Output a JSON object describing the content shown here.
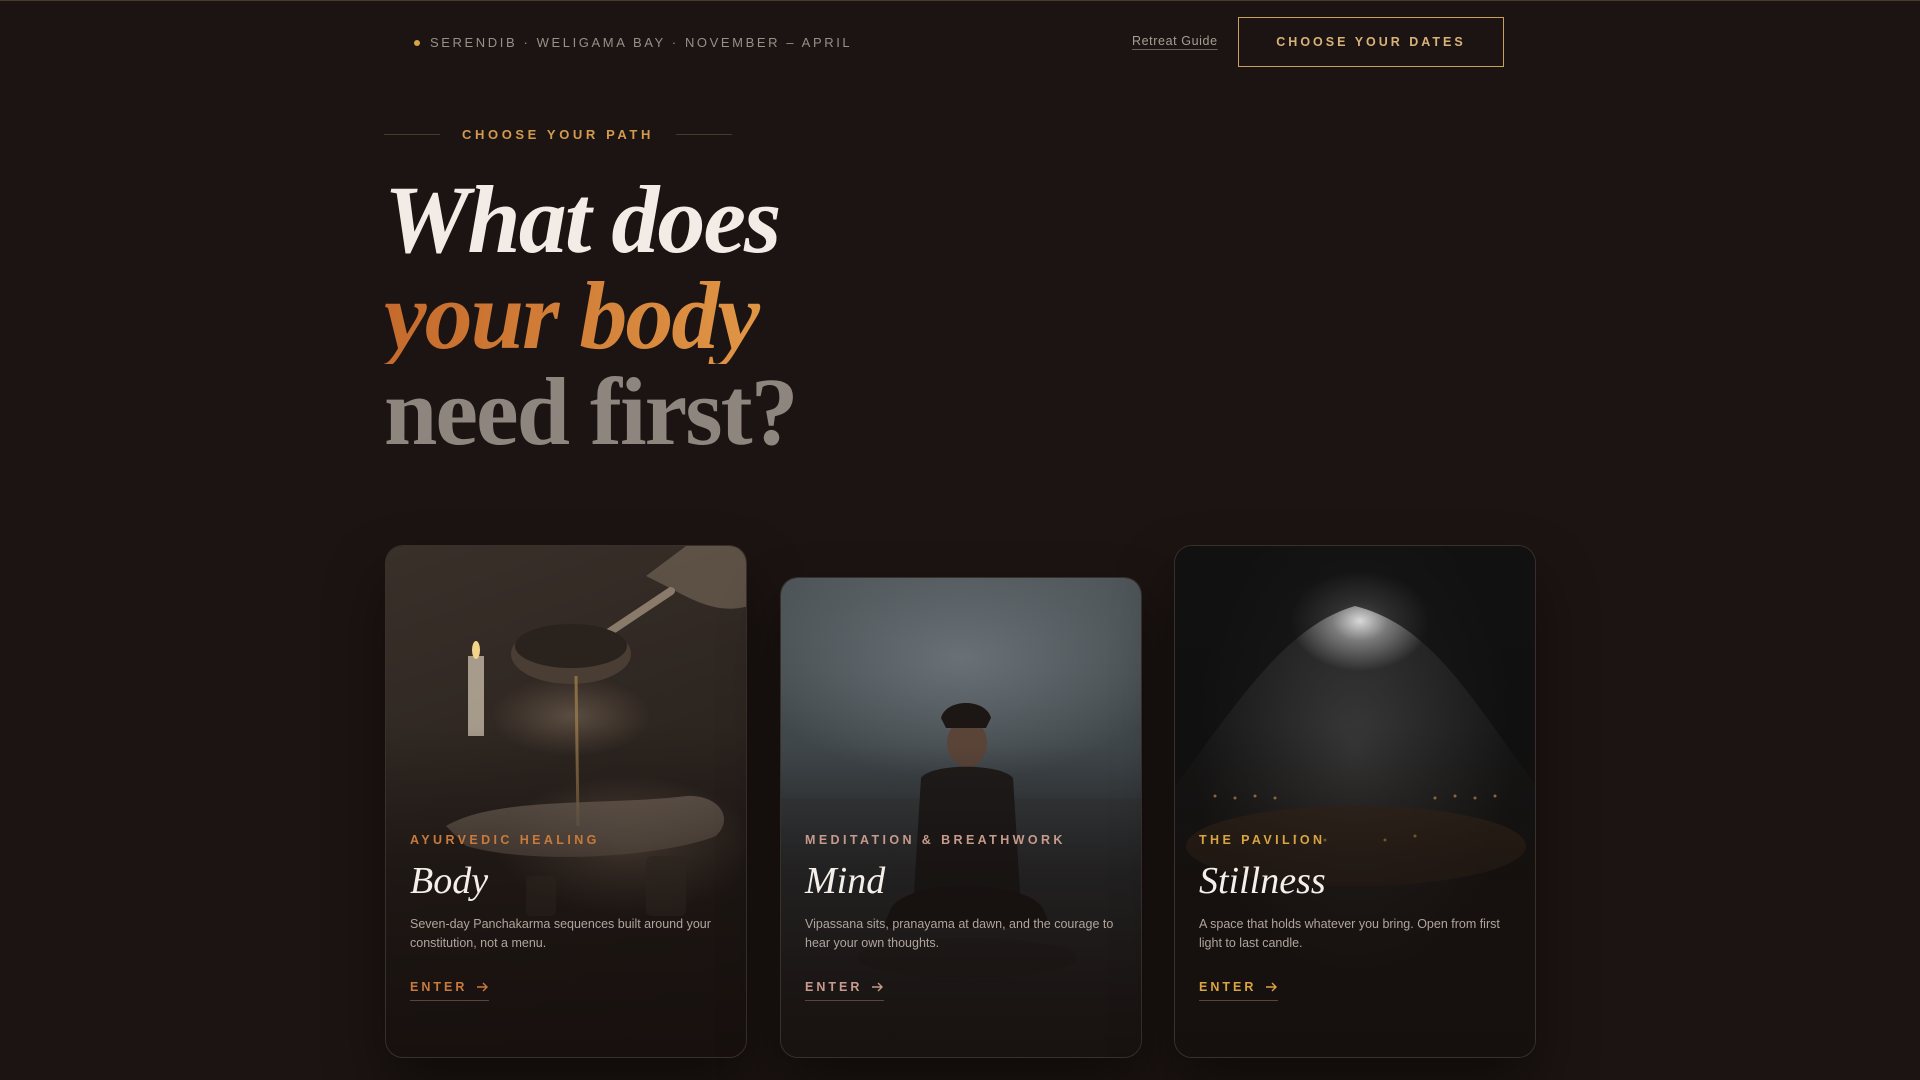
{
  "header": {
    "brand": "SERENDIB · WELIGAMA BAY · NOVEMBER – APRIL",
    "guide_link": "Retreat Guide",
    "cta": "CHOOSE YOUR DATES"
  },
  "hero": {
    "eyebrow": "CHOOSE YOUR PATH",
    "line1": "What does",
    "line2": "your body",
    "line3": "need first?"
  },
  "cards": [
    {
      "kicker": "AYURVEDIC HEALING",
      "title": "Body",
      "description": "Seven-day Panchakarma sequences built around your constitution, not a menu.",
      "action": "ENTER",
      "accent": "#c87a3c"
    },
    {
      "kicker": "MEDITATION & BREATHWORK",
      "title": "Mind",
      "description": "Vipassana sits, pranayama at dawn, and the courage to hear your own thoughts.",
      "action": "ENTER",
      "accent": "#c79a8c"
    },
    {
      "kicker": "THE PAVILION",
      "title": "Stillness",
      "description": "A space that holds whatever you bring. Open from first light to last candle.",
      "action": "ENTER",
      "accent": "#d9a441"
    }
  ],
  "colors": {
    "background": "#1c1412",
    "gold": "#d9a441",
    "orange": "#d38a3e"
  }
}
